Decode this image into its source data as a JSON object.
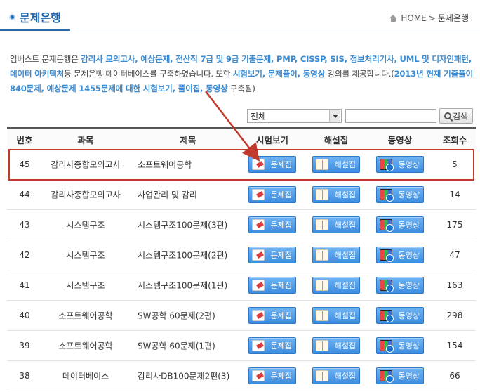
{
  "header": {
    "page_title": "문제은행",
    "breadcrumb_home": "HOME",
    "breadcrumb_sep": ">",
    "breadcrumb_current": "문제은행"
  },
  "intro": {
    "p1": "임베스트 문제은행은 ",
    "hl1": "감리사 모의고사, 예상문제, 전산직 7급 및 9급 기출문제, PMP, CISSP, SIS, 정보처리기사, UML 및 디자인패턴, 데이터 아키텍처",
    "p2": "등 문제은행 데이터베이스를 구축하였습니다. 또한 ",
    "hl2": "시험보기, 문제풀이, 동영상",
    "p3": " 강의를 제공합니다.(",
    "hl3": "2013년 현재 기출풀이 840문제, 예상문제 1455문제에 대한 시험보기, 풀이집, 동영상",
    "p4": " 구축됨)"
  },
  "search": {
    "category_value": "전체",
    "input_value": "",
    "button_label": "검색"
  },
  "table": {
    "headers": [
      "번호",
      "과목",
      "제목",
      "시험보기",
      "해설집",
      "동영상",
      "조회수"
    ],
    "exam_label": "문제집",
    "solution_label": "해설집",
    "video_label": "동영상",
    "rows": [
      {
        "no": "45",
        "subject": "감리사종합모의고사",
        "title": "소프트웨어공학",
        "views": "5"
      },
      {
        "no": "44",
        "subject": "감리사종합모의고사",
        "title": "사업관리 및 감리",
        "views": "14"
      },
      {
        "no": "43",
        "subject": "시스템구조",
        "title": "시스템구조100문제(3편)",
        "views": "175"
      },
      {
        "no": "42",
        "subject": "시스템구조",
        "title": "시스템구조100문제(2편)",
        "views": "47"
      },
      {
        "no": "41",
        "subject": "시스템구조",
        "title": "시스템구조100문제(1편)",
        "views": "163"
      },
      {
        "no": "40",
        "subject": "소프트웨어공학",
        "title": "SW공학 60문제(2편)",
        "views": "298"
      },
      {
        "no": "39",
        "subject": "소프트웨어공학",
        "title": "SW공학 60문제(1편)",
        "views": "154"
      },
      {
        "no": "38",
        "subject": "데이터베이스",
        "title": "감리사DB100문제2편(3)",
        "views": "66"
      }
    ]
  },
  "colors": {
    "accent": "#1b63ab",
    "highlight_text": "#3a8bd1",
    "annotation": "#c0392b",
    "button": "#3d8de0"
  }
}
